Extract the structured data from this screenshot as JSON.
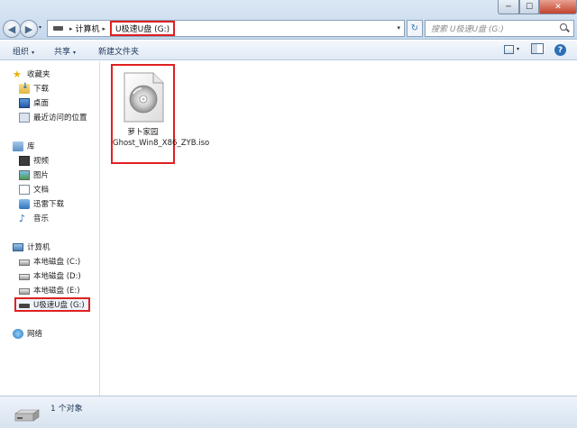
{
  "window": {
    "minimize_glyph": "─",
    "maximize_glyph": "☐",
    "close_glyph": "✕"
  },
  "address_bar": {
    "separator": "▸",
    "segments": [
      "计算机",
      "U极速U盘 (G:)"
    ],
    "dropdown_glyph": "▾"
  },
  "nav_buttons": {
    "back_glyph": "◀",
    "forward_glyph": "▶",
    "refresh_glyph": "↻"
  },
  "search": {
    "placeholder": "搜索 U极速U盘 (G:)"
  },
  "toolbar": {
    "organize_label": "组织",
    "share_label": "共享",
    "new_folder_label": "新建文件夹",
    "dropdown_glyph": "▾",
    "help_glyph": "?"
  },
  "sidebar": {
    "favorites": {
      "label": "收藏夹",
      "items": [
        "下载",
        "桌面",
        "最近访问的位置"
      ]
    },
    "libraries": {
      "label": "库",
      "items": [
        "视频",
        "图片",
        "文档",
        "迅雷下载",
        "音乐"
      ]
    },
    "computer": {
      "label": "计算机",
      "items": [
        "本地磁盘 (C:)",
        "本地磁盘 (D:)",
        "本地磁盘 (E:)",
        "U极速U盘 (G:)"
      ],
      "selected_index": 3
    },
    "network": {
      "label": "网络"
    }
  },
  "files": [
    {
      "name": "萝卜家园Ghost_Win8_X86_ZYB.iso",
      "icon": "disc-image-icon"
    }
  ],
  "status_bar": {
    "count_text": "1 个对象"
  },
  "colors": {
    "highlight_box": "#e02020",
    "toolbar_text": "#1e395b"
  }
}
